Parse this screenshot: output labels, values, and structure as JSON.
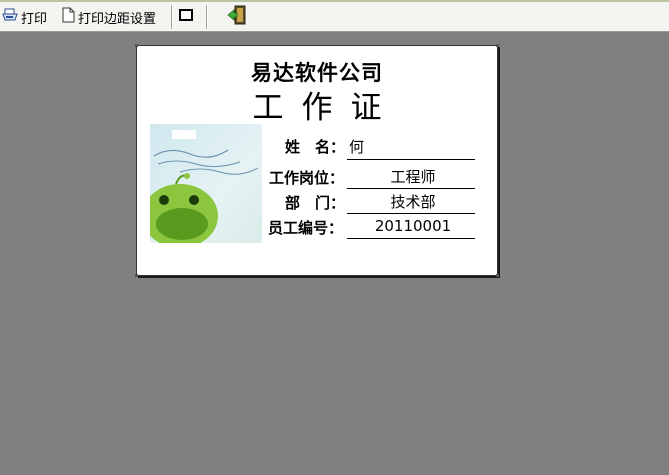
{
  "toolbar": {
    "print_label": "打印",
    "margin_label": "打印边距设置"
  },
  "card": {
    "company": "易达软件公司",
    "title": "工作证",
    "fields": [
      {
        "label": "姓　名：",
        "value": "何"
      },
      {
        "label": "工作岗位：",
        "value": "工程师"
      },
      {
        "label": "部　门：",
        "value": "技术部"
      },
      {
        "label": "员工编号：",
        "value": "20110001"
      }
    ]
  },
  "icons": [
    "printer-icon",
    "page-icon",
    "frame-icon",
    "exit-door-icon"
  ]
}
